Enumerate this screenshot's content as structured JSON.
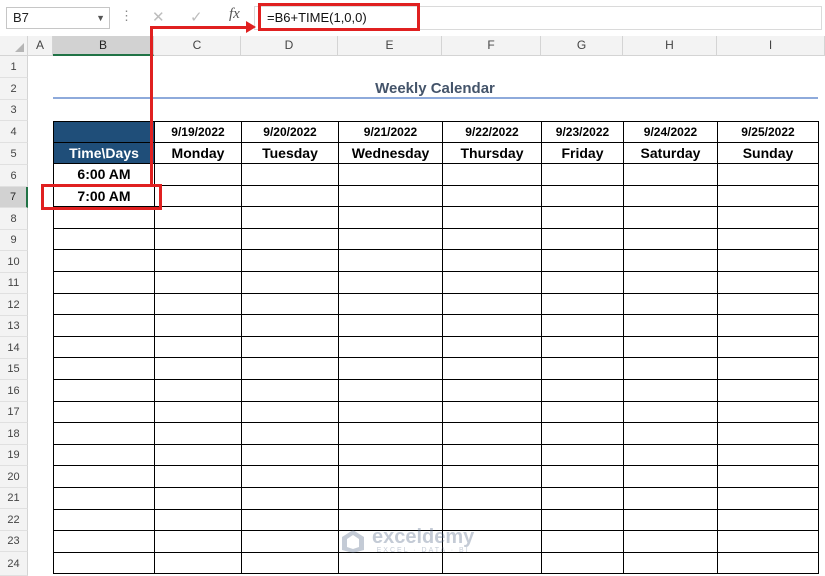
{
  "formula_bar": {
    "name_box": "B7",
    "formula": "=B6+TIME(1,0,0)",
    "fx_label": "fx",
    "cancel_glyph": "✕",
    "enter_glyph": "✓",
    "dots_glyph": "⋮"
  },
  "columns": [
    "A",
    "B",
    "C",
    "D",
    "E",
    "F",
    "G",
    "H",
    "I"
  ],
  "selected_column": "B",
  "rows": [
    "1",
    "2",
    "3",
    "4",
    "5",
    "6",
    "7",
    "8",
    "9",
    "10",
    "11",
    "12",
    "13",
    "14",
    "15",
    "16",
    "17",
    "18",
    "19",
    "20",
    "21",
    "22",
    "23",
    "24"
  ],
  "selected_row": "7",
  "sheet": {
    "title": "Weekly Calendar",
    "corner_label": "Time\\Days",
    "dates": [
      "9/19/2022",
      "9/20/2022",
      "9/21/2022",
      "9/22/2022",
      "9/23/2022",
      "9/24/2022",
      "9/25/2022"
    ],
    "days": [
      "Monday",
      "Tuesday",
      "Wednesday",
      "Thursday",
      "Friday",
      "Saturday",
      "Sunday"
    ],
    "times": [
      "6:00 AM",
      "7:00 AM"
    ]
  },
  "watermark": {
    "name": "exceldemy",
    "tagline": "EXCEL · DATA · BI"
  },
  "colors": {
    "header_fill": "#1f4e79",
    "highlight": "#e02020",
    "title_text": "#44546a",
    "title_rule": "#8eaadb",
    "selection": "#217346"
  }
}
